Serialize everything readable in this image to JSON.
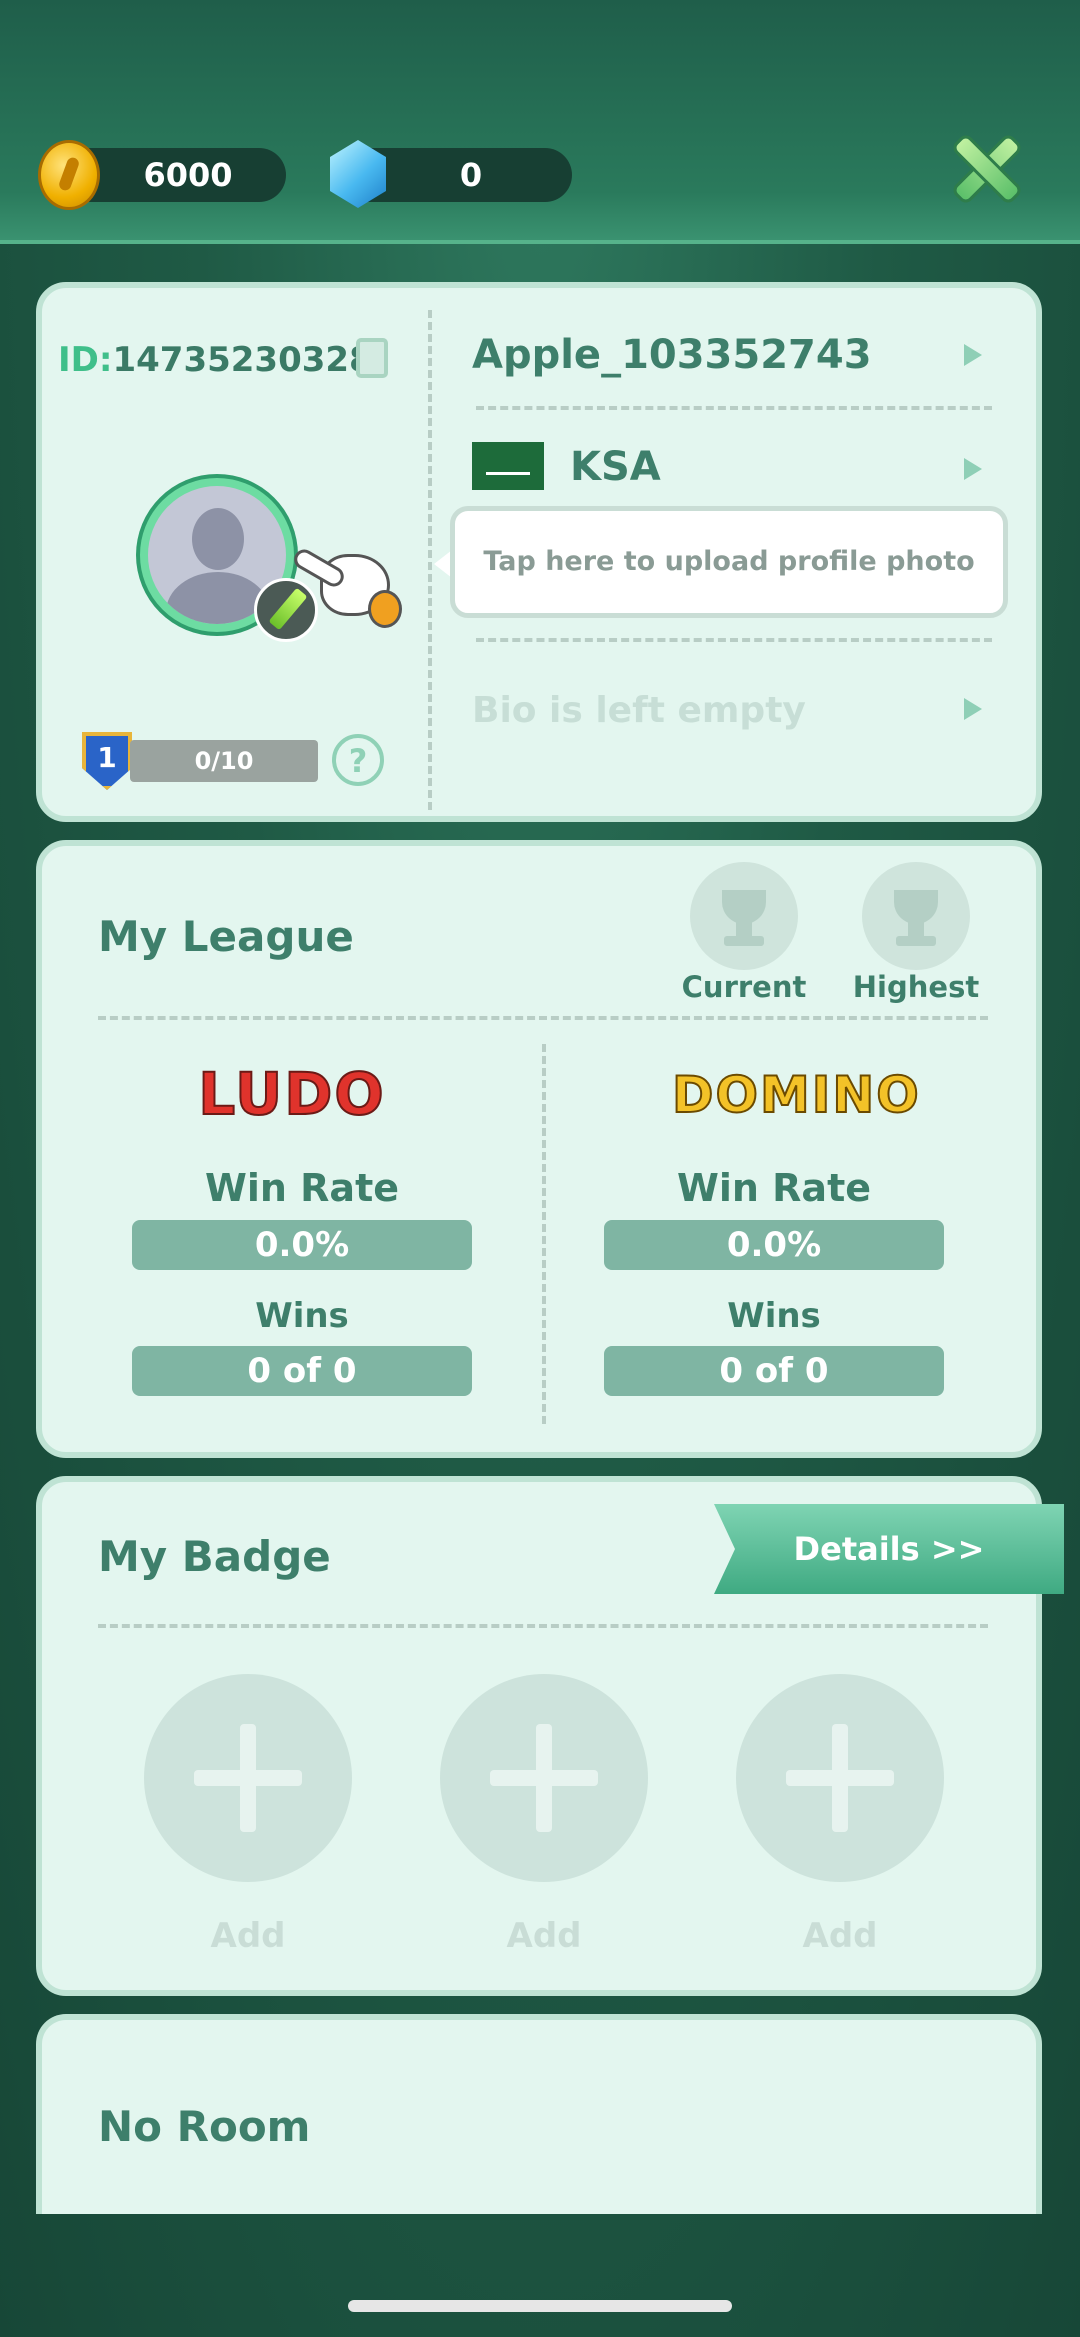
{
  "header": {
    "coins": "6000",
    "gems": "0"
  },
  "profile": {
    "id_label": "ID:",
    "id_value": "14735230328",
    "username": "Apple_103352743",
    "country": "KSA",
    "bio": "Bio is left empty",
    "level": "1",
    "xp": "0/10",
    "help": "?",
    "tooltip": "Tap here to upload profile photo"
  },
  "league": {
    "title": "My League",
    "current_label": "Current",
    "highest_label": "Highest",
    "games": [
      {
        "logo": "LUDO",
        "win_rate_label": "Win Rate",
        "win_rate": "0.0%",
        "wins_label": "Wins",
        "wins": "0 of 0"
      },
      {
        "logo": "DOMINO",
        "win_rate_label": "Win Rate",
        "win_rate": "0.0%",
        "wins_label": "Wins",
        "wins": "0 of 0"
      }
    ]
  },
  "badge": {
    "title": "My Badge",
    "details_label": "Details  >>",
    "slots": [
      {
        "label": "Add"
      },
      {
        "label": "Add"
      },
      {
        "label": "Add"
      }
    ]
  },
  "room": {
    "title": "No Room"
  },
  "colors": {
    "accent": "#3fbf8a",
    "card_bg": "#e3f6ef",
    "text_primary": "#3e7f6b"
  }
}
